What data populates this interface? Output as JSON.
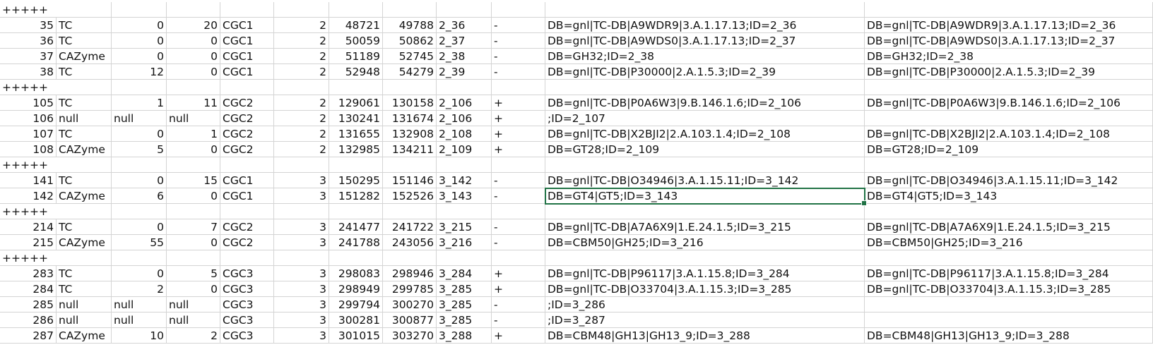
{
  "sheet": {
    "top_fragment": "",
    "rows": [
      {
        "type": "sep",
        "label": "+++++"
      },
      {
        "type": "data",
        "cells": [
          "35",
          "TC",
          "0",
          "20",
          "CGC1",
          "2",
          "48721",
          "49788",
          "2_36",
          "-",
          "DB=gnl|TC-DB|A9WDR9|3.A.1.17.13;ID=2_36",
          "DB=gnl|TC-DB|A9WDR9|3.A.1.17.13;ID=2_36"
        ]
      },
      {
        "type": "data",
        "cells": [
          "36",
          "TC",
          "0",
          "0",
          "CGC1",
          "2",
          "50059",
          "50862",
          "2_37",
          "-",
          "DB=gnl|TC-DB|A9WDS0|3.A.1.17.13;ID=2_37",
          "DB=gnl|TC-DB|A9WDS0|3.A.1.17.13;ID=2_37"
        ]
      },
      {
        "type": "data",
        "cells": [
          "37",
          "CAZyme",
          "0",
          "0",
          "CGC1",
          "2",
          "51189",
          "52745",
          "2_38",
          "-",
          "DB=GH32;ID=2_38",
          "DB=GH32;ID=2_38"
        ]
      },
      {
        "type": "data",
        "cells": [
          "38",
          "TC",
          "12",
          "0",
          "CGC1",
          "2",
          "52948",
          "54279",
          "2_39",
          "-",
          "DB=gnl|TC-DB|P30000|2.A.1.5.3;ID=2_39",
          "DB=gnl|TC-DB|P30000|2.A.1.5.3;ID=2_39"
        ]
      },
      {
        "type": "sep",
        "label": "+++++"
      },
      {
        "type": "data",
        "cells": [
          "105",
          "TC",
          "1",
          "11",
          "CGC2",
          "2",
          "129061",
          "130158",
          "2_106",
          "+",
          "DB=gnl|TC-DB|P0A6W3|9.B.146.1.6;ID=2_106",
          "DB=gnl|TC-DB|P0A6W3|9.B.146.1.6;ID=2_106"
        ]
      },
      {
        "type": "data",
        "cells": [
          "106",
          "null",
          "null",
          "null",
          "CGC2",
          "2",
          "130241",
          "131674",
          "2_106",
          "+",
          ";ID=2_107",
          ""
        ]
      },
      {
        "type": "data",
        "cells": [
          "107",
          "TC",
          "0",
          "1",
          "CGC2",
          "2",
          "131655",
          "132908",
          "2_108",
          "+",
          "DB=gnl|TC-DB|X2BJI2|2.A.103.1.4;ID=2_108",
          "DB=gnl|TC-DB|X2BJI2|2.A.103.1.4;ID=2_108"
        ]
      },
      {
        "type": "data",
        "cells": [
          "108",
          "CAZyme",
          "5",
          "0",
          "CGC2",
          "2",
          "132985",
          "134211",
          "2_109",
          "+",
          "DB=GT28;ID=2_109",
          "DB=GT28;ID=2_109"
        ]
      },
      {
        "type": "sep",
        "label": "+++++"
      },
      {
        "type": "data",
        "cells": [
          "141",
          "TC",
          "0",
          "15",
          "CGC1",
          "3",
          "150295",
          "151146",
          "3_142",
          "-",
          "DB=gnl|TC-DB|O34946|3.A.1.15.11;ID=3_142",
          "DB=gnl|TC-DB|O34946|3.A.1.15.11;ID=3_142"
        ]
      },
      {
        "type": "data",
        "cells": [
          "142",
          "CAZyme",
          "6",
          "0",
          "CGC1",
          "3",
          "151282",
          "152526",
          "3_143",
          "-",
          "DB=GT4|GT5;ID=3_143",
          "DB=GT4|GT5;ID=3_143"
        ],
        "selected_col": 10
      },
      {
        "type": "sep",
        "label": "+++++"
      },
      {
        "type": "data",
        "cells": [
          "214",
          "TC",
          "0",
          "7",
          "CGC2",
          "3",
          "241477",
          "241722",
          "3_215",
          "-",
          "DB=gnl|TC-DB|A7A6X9|1.E.24.1.5;ID=3_215",
          "DB=gnl|TC-DB|A7A6X9|1.E.24.1.5;ID=3_215"
        ]
      },
      {
        "type": "data",
        "cells": [
          "215",
          "CAZyme",
          "55",
          "0",
          "CGC2",
          "3",
          "241788",
          "243056",
          "3_216",
          "-",
          "DB=CBM50|GH25;ID=3_216",
          "DB=CBM50|GH25;ID=3_216"
        ]
      },
      {
        "type": "sep",
        "label": "+++++"
      },
      {
        "type": "data",
        "cells": [
          "283",
          "TC",
          "0",
          "5",
          "CGC3",
          "3",
          "298083",
          "298946",
          "3_284",
          "+",
          "DB=gnl|TC-DB|P96117|3.A.1.15.8;ID=3_284",
          "DB=gnl|TC-DB|P96117|3.A.1.15.8;ID=3_284"
        ]
      },
      {
        "type": "data",
        "cells": [
          "284",
          "TC",
          "2",
          "0",
          "CGC3",
          "3",
          "298949",
          "299785",
          "3_285",
          "+",
          "DB=gnl|TC-DB|O33704|3.A.1.15.3;ID=3_285",
          "DB=gnl|TC-DB|O33704|3.A.1.15.3;ID=3_285"
        ]
      },
      {
        "type": "data",
        "cells": [
          "285",
          "null",
          "null",
          "null",
          "CGC3",
          "3",
          "299794",
          "300270",
          "3_285",
          "-",
          ";ID=3_286",
          ""
        ]
      },
      {
        "type": "data",
        "cells": [
          "286",
          "null",
          "null",
          "null",
          "CGC3",
          "3",
          "300281",
          "300877",
          "3_285",
          "-",
          ";ID=3_287",
          ""
        ]
      },
      {
        "type": "data",
        "cells": [
          "287",
          "CAZyme",
          "10",
          "2",
          "CGC3",
          "3",
          "301015",
          "303270",
          "3_288",
          "+",
          "DB=CBM48|GH13|GH13_9;ID=3_288",
          "DB=CBM48|GH13|GH13_9;ID=3_288"
        ]
      }
    ]
  },
  "colors": {
    "gridline": "#d4d4d4",
    "selection": "#217346"
  }
}
